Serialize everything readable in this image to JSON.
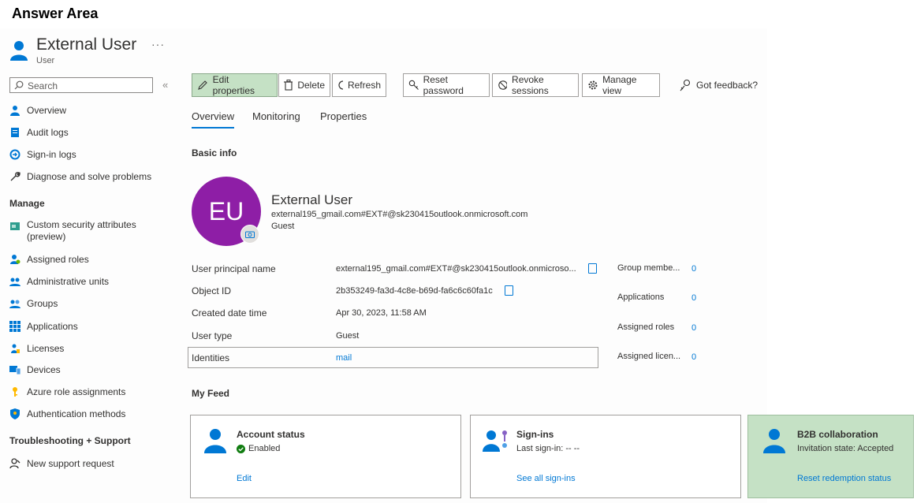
{
  "answer_area": "Answer Area",
  "header": {
    "title": "External User",
    "subtitle": "User",
    "more": "···"
  },
  "search": {
    "placeholder": "Search",
    "collapse": "«"
  },
  "sidebar": {
    "items": [
      {
        "label": "Overview",
        "icon": "person-icon"
      },
      {
        "label": "Audit logs",
        "icon": "audit-log-icon"
      },
      {
        "label": "Sign-in logs",
        "icon": "sign-in-icon"
      },
      {
        "label": "Diagnose and solve problems",
        "icon": "wrench-icon"
      }
    ],
    "manage_heading": "Manage",
    "manage_items": [
      {
        "label": "Custom security attributes",
        "label2": "(preview)",
        "icon": "attributes-icon"
      },
      {
        "label": "Assigned roles",
        "icon": "roles-icon"
      },
      {
        "label": "Administrative units",
        "icon": "admin-units-icon"
      },
      {
        "label": "Groups",
        "icon": "groups-icon"
      },
      {
        "label": "Applications",
        "icon": "apps-grid-icon"
      },
      {
        "label": "Licenses",
        "icon": "licenses-icon"
      },
      {
        "label": "Devices",
        "icon": "devices-icon"
      },
      {
        "label": "Azure role assignments",
        "icon": "key-icon"
      },
      {
        "label": "Authentication methods",
        "icon": "shield-icon"
      }
    ],
    "support_heading": "Troubleshooting + Support",
    "support_items": [
      {
        "label": "New support request",
        "icon": "support-person-icon"
      }
    ]
  },
  "toolbar": {
    "edit": "Edit properties",
    "delete": "Delete",
    "refresh": "Refresh",
    "reset_password": "Reset password",
    "revoke_sessions": "Revoke sessions",
    "manage_view": "Manage view",
    "feedback": "Got feedback?"
  },
  "tabs": [
    "Overview",
    "Monitoring",
    "Properties"
  ],
  "basic_info": {
    "heading": "Basic info",
    "avatar_initials": "EU",
    "name": "External User",
    "email": "external195_gmail.com#EXT#@sk230415outlook.onmicrosoft.com",
    "type": "Guest",
    "fields": [
      {
        "label": "User principal name",
        "value": "external195_gmail.com#EXT#@sk230415outlook.onmicroso..."
      },
      {
        "label": "Object ID",
        "value": "2b353249-fa3d-4c8e-b69d-fa6c6c60fa1c"
      },
      {
        "label": "Created date time",
        "value": "Apr 30, 2023, 11:58 AM"
      },
      {
        "label": "User type",
        "value": "Guest"
      },
      {
        "label": "Identities",
        "value": "mail"
      }
    ],
    "stats": [
      {
        "label": "Group membe...",
        "value": "0"
      },
      {
        "label": "Applications",
        "value": "0"
      },
      {
        "label": "Assigned roles",
        "value": "0"
      },
      {
        "label": "Assigned licen...",
        "value": "0"
      }
    ]
  },
  "feed": {
    "heading": "My Feed",
    "cards": [
      {
        "title": "Account status",
        "sub": "Enabled",
        "link": "Edit"
      },
      {
        "title": "Sign-ins",
        "sub": "Last sign-in: -- --",
        "link": "See all sign-ins"
      },
      {
        "title": "B2B collaboration",
        "sub": "Invitation state: Accepted",
        "link": "Reset redemption status"
      }
    ]
  },
  "colors": {
    "accent": "#0078d4",
    "avatar": "#8e1ea6",
    "highlight": "#c5e1c5",
    "enabled": "#107c10"
  }
}
